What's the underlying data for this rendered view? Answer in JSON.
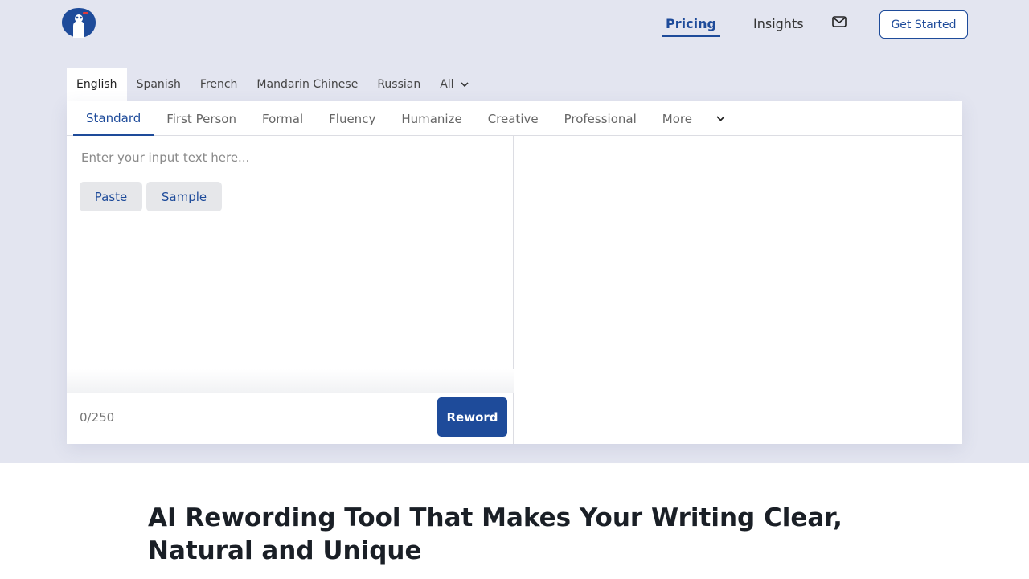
{
  "nav": {
    "pricing": "Pricing",
    "insights": "Insights",
    "mail_icon": "mail-icon",
    "cta": "Get Started"
  },
  "languages": {
    "tabs": [
      "English",
      "Spanish",
      "French",
      "Mandarin Chinese",
      "Russian",
      "All"
    ],
    "active": "English"
  },
  "modes": {
    "tabs": [
      "Standard",
      "First Person",
      "Formal",
      "Fluency",
      "Humanize",
      "Creative",
      "Professional",
      "More"
    ],
    "active": "Standard"
  },
  "editor": {
    "placeholder": "Enter your input text here...",
    "paste": "Paste",
    "sample": "Sample",
    "counter": "0/250",
    "reword": "Reword"
  },
  "article": {
    "headline": "AI Rewording Tool That Makes Your Writing Clear, Natural and Unique",
    "intro": ""
  },
  "colors": {
    "accent": "#1e4b9a",
    "band": "#e3e5f0"
  }
}
